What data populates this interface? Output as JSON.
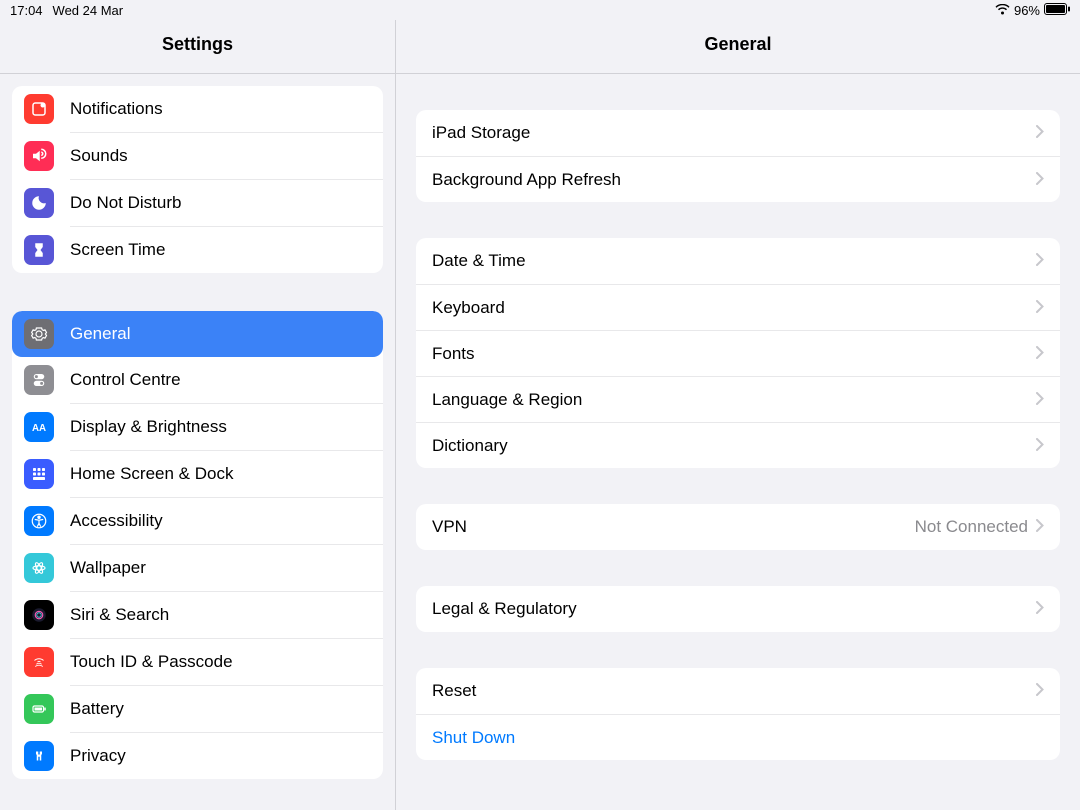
{
  "status": {
    "time": "17:04",
    "date": "Wed 24 Mar",
    "battery": "96%"
  },
  "sidebar": {
    "title": "Settings",
    "group1": [
      {
        "id": "notifications",
        "label": "Notifications",
        "color": "#ff3b30"
      },
      {
        "id": "sounds",
        "label": "Sounds",
        "color": "#ff2d55"
      },
      {
        "id": "dnd",
        "label": "Do Not Disturb",
        "color": "#5856d6"
      },
      {
        "id": "screentime",
        "label": "Screen Time",
        "color": "#5856d6"
      }
    ],
    "group2": [
      {
        "id": "general",
        "label": "General",
        "color": "#8e8e93",
        "selected": true
      },
      {
        "id": "controlcentre",
        "label": "Control Centre",
        "color": "#8e8e93"
      },
      {
        "id": "display",
        "label": "Display & Brightness",
        "color": "#007aff"
      },
      {
        "id": "home",
        "label": "Home Screen & Dock",
        "color": "#3a5cff"
      },
      {
        "id": "accessibility",
        "label": "Accessibility",
        "color": "#007aff"
      },
      {
        "id": "wallpaper",
        "label": "Wallpaper",
        "color": "#34c8d9"
      },
      {
        "id": "siri",
        "label": "Siri & Search",
        "color": "#000000"
      },
      {
        "id": "touchid",
        "label": "Touch ID & Passcode",
        "color": "#ff3b30"
      },
      {
        "id": "battery",
        "label": "Battery",
        "color": "#34c759"
      },
      {
        "id": "privacy",
        "label": "Privacy",
        "color": "#007aff"
      }
    ]
  },
  "detail": {
    "title": "General",
    "groups": [
      [
        {
          "id": "storage",
          "label": "iPad Storage"
        },
        {
          "id": "bgrefresh",
          "label": "Background App Refresh"
        }
      ],
      [
        {
          "id": "datetime",
          "label": "Date & Time"
        },
        {
          "id": "keyboard",
          "label": "Keyboard"
        },
        {
          "id": "fonts",
          "label": "Fonts"
        },
        {
          "id": "language",
          "label": "Language & Region"
        },
        {
          "id": "dictionary",
          "label": "Dictionary"
        }
      ],
      [
        {
          "id": "vpn",
          "label": "VPN",
          "value": "Not Connected"
        }
      ],
      [
        {
          "id": "legal",
          "label": "Legal & Regulatory"
        }
      ],
      [
        {
          "id": "reset",
          "label": "Reset"
        },
        {
          "id": "shutdown",
          "label": "Shut Down",
          "link": true,
          "nochevron": true
        }
      ]
    ]
  }
}
